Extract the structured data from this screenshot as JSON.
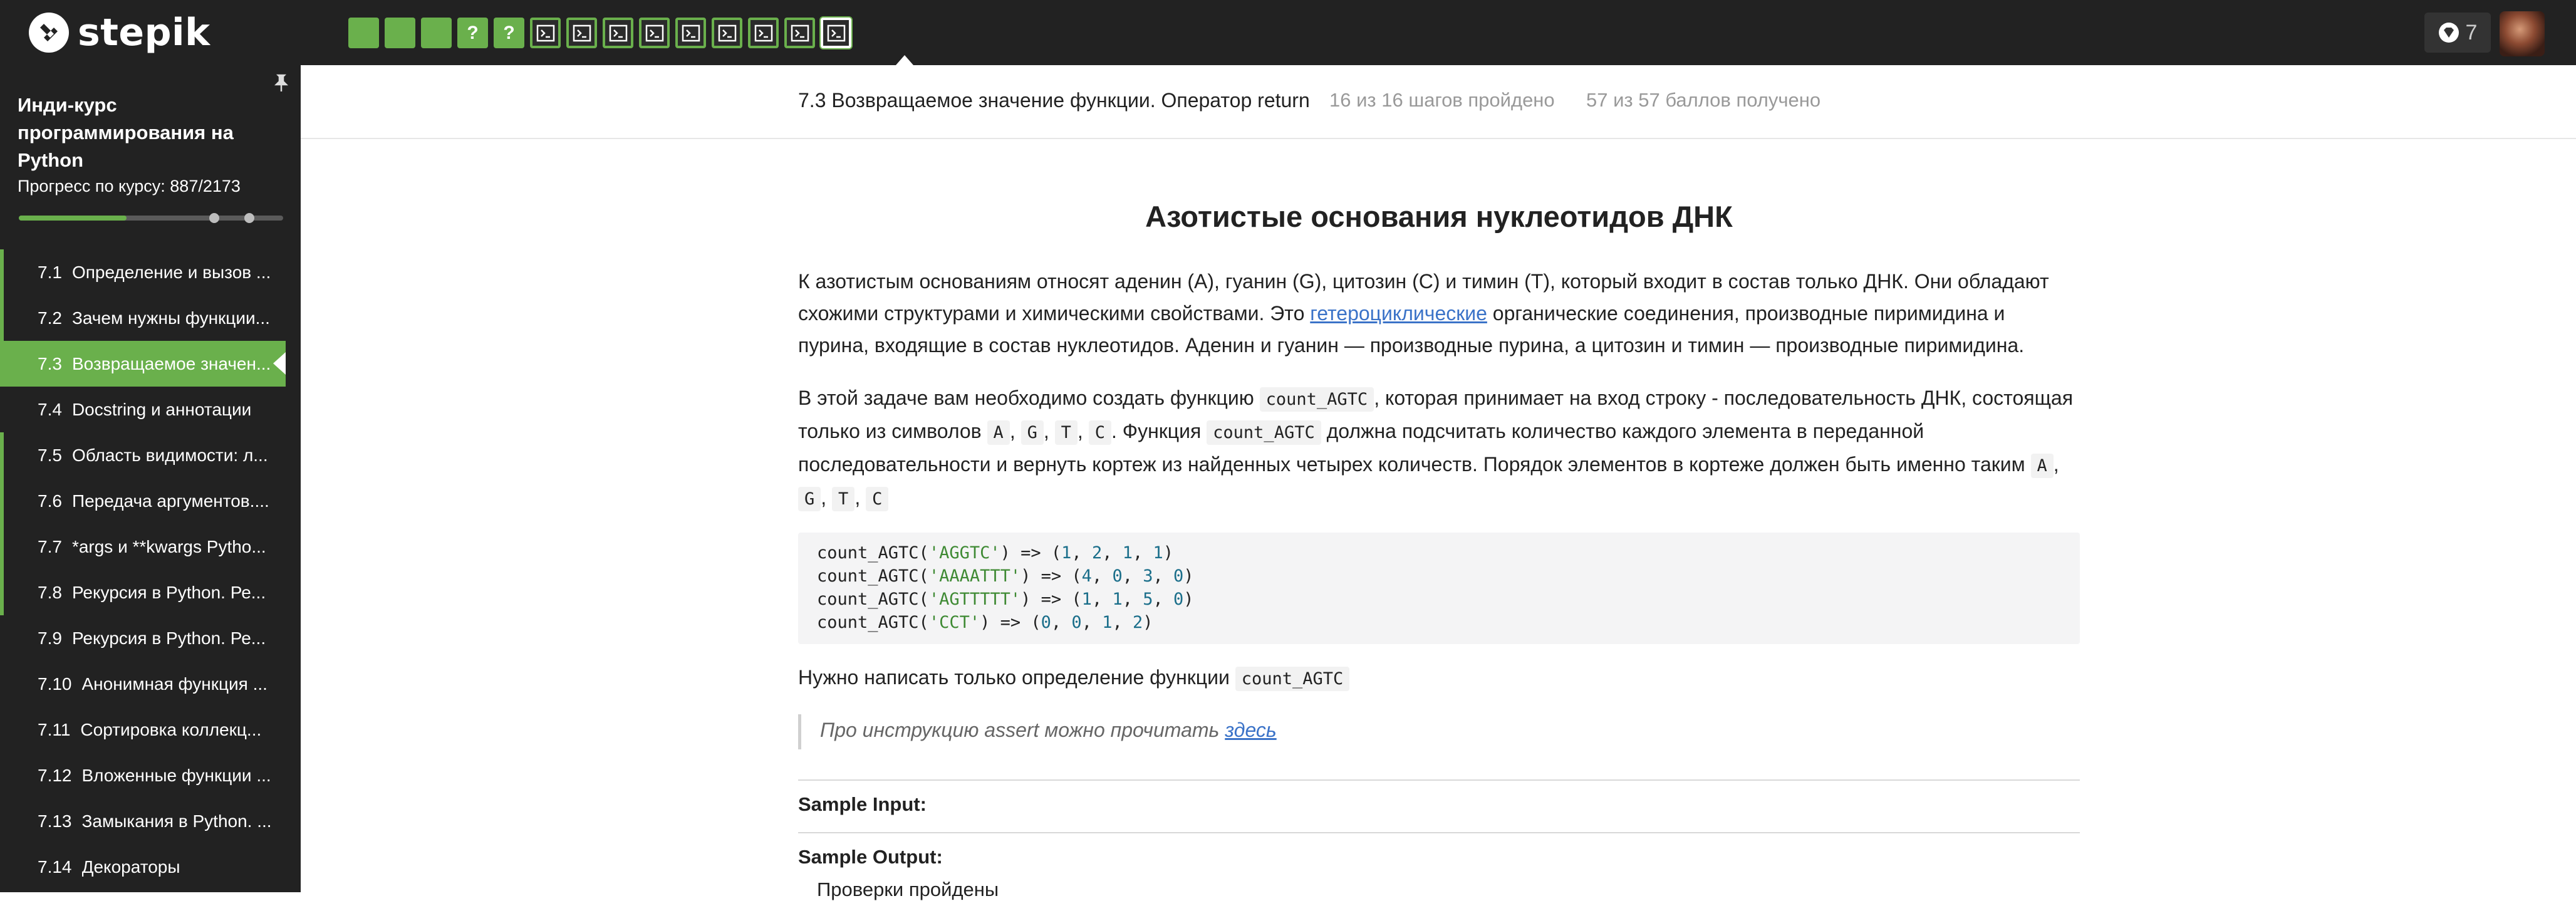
{
  "brand": {
    "logo_text": "stepik"
  },
  "topbar": {
    "steps": [
      {
        "type": "text",
        "status": "passed"
      },
      {
        "type": "text",
        "status": "passed"
      },
      {
        "type": "text",
        "status": "passed"
      },
      {
        "type": "quiz",
        "label": "?",
        "status": "passed"
      },
      {
        "type": "quiz",
        "label": "?",
        "status": "passed"
      },
      {
        "type": "code",
        "status": "passed"
      },
      {
        "type": "code",
        "status": "passed"
      },
      {
        "type": "code",
        "status": "passed"
      },
      {
        "type": "code",
        "status": "passed"
      },
      {
        "type": "code",
        "status": "passed"
      },
      {
        "type": "code",
        "status": "passed"
      },
      {
        "type": "code",
        "status": "passed"
      },
      {
        "type": "code",
        "status": "passed"
      },
      {
        "type": "code",
        "status": "passed",
        "active": true
      }
    ],
    "notifications_count": "7",
    "colors": {
      "bar": "#222222",
      "accent": "#6ab04c"
    }
  },
  "sidebar": {
    "course_title": "Инди-курс программирования на Python",
    "progress_label": "Прогресс по курсу:  887/2173",
    "progress_fraction": 0.408,
    "lessons": [
      {
        "num": "7.1",
        "label": "Определение и вызов ..."
      },
      {
        "num": "7.2",
        "label": "Зачем нужны функции..."
      },
      {
        "num": "7.3",
        "label": "Возвращаемое значен...",
        "active": true
      },
      {
        "num": "7.4",
        "label": "Docstring и аннотации"
      },
      {
        "num": "7.5",
        "label": "Область видимости: л..."
      },
      {
        "num": "7.6",
        "label": "Передача аргументов...."
      },
      {
        "num": "7.7",
        "label": "*args и **kwargs Pytho..."
      },
      {
        "num": "7.8",
        "label": "Рекурсия в Python. Ре..."
      },
      {
        "num": "7.9",
        "label": "Рекурсия в Python. Ре..."
      },
      {
        "num": "7.10",
        "label": "Анонимная функция ..."
      },
      {
        "num": "7.11",
        "label": "Сортировка коллекц..."
      },
      {
        "num": "7.12",
        "label": "Вложенные функции ..."
      },
      {
        "num": "7.13",
        "label": "Замыкания в Python. ..."
      },
      {
        "num": "7.14",
        "label": "Декораторы"
      }
    ]
  },
  "lesson_header": {
    "title": "7.3 Возвращаемое значение функции. Оператор return",
    "steps_done": "16 из 16 шагов пройдено",
    "score": "57 из 57 баллов  получено"
  },
  "article": {
    "heading": "Азотистые основания нуклеотидов ДНК",
    "p1_a": "К азотистым основаниям относят аденин (A), гуанин (G), цитозин (C) и тимин (T), который входит в состав только ДНК. Они обладают схожими структурами и химическими свойствами. Это ",
    "p1_link": "гетероциклические",
    "p1_b": " органические соединения, производные пиримидина и пурина, входящие в состав нуклеотидов. Аденин и гуанин — производные пурина, а цитозин и тимин — производные пиримидина.",
    "p2_a": "В этой задаче вам необходимо создать функцию ",
    "p2_code1": "count_AGTC",
    "p2_b": ", которая принимает на вход строку - последовательность ДНК, состоящая только из символов ",
    "sym_a": "A",
    "sym_g": "G",
    "sym_t": "T",
    "sym_c": "C",
    "p2_c": ". Функция ",
    "p2_code2": "count_AGTC",
    "p2_d": " должна подсчитать количество каждого элемента в переданной последовательности и вернуть кортеж из найденных четырех количеств. Порядок элементов в кортеже должен быть именно таким ",
    "sep": ",",
    "code_lines": [
      {
        "fn": "count_AGTC(",
        "arg": "'AGGTC'",
        "mid": ") => (",
        "n": [
          "1",
          "2",
          "1",
          "1"
        ]
      },
      {
        "fn": "count_AGTC(",
        "arg": "'AAAATTT'",
        "mid": ") => (",
        "n": [
          "4",
          "0",
          "3",
          "0"
        ]
      },
      {
        "fn": "count_AGTC(",
        "arg": "'AGTTTTT'",
        "mid": ") => (",
        "n": [
          "1",
          "1",
          "5",
          "0"
        ]
      },
      {
        "fn": "count_AGTC(",
        "arg": "'CCT'",
        "mid": ") => (",
        "n": [
          "0",
          "0",
          "1",
          "2"
        ]
      }
    ],
    "p3_a": "Нужно написать только определение функции ",
    "p3_code": "count_AGTC",
    "quote_a": "Про инструкцию assert можно прочитать ",
    "quote_link": "здесь",
    "sample_input_label": "Sample Input:",
    "sample_output_label": "Sample Output:",
    "tail_text": "Проверки пройдены"
  }
}
